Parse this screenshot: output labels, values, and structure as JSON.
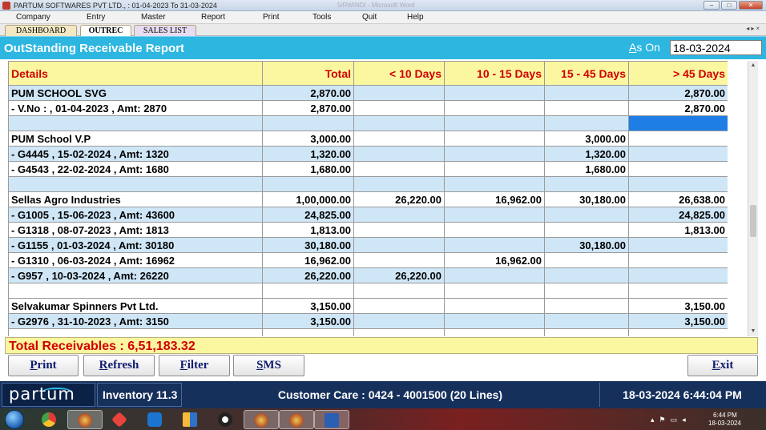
{
  "window": {
    "title": "PARTUM SOFTWARES PVT LTD., : 01-04-2023 To 31-03-2024",
    "faded_title": "5/RWINDI - Microsoft Word"
  },
  "menu": [
    "Company",
    "Entry",
    "Master",
    "Report",
    "Print",
    "Tools",
    "Quit",
    "Help"
  ],
  "tabs": [
    "DASHBOARD",
    "OUTREC",
    "SALES LIST"
  ],
  "report": {
    "title": "OutStanding Receivable Report",
    "as_on_prefix": "A",
    "as_on_rest": "s On",
    "date": "18-03-2024"
  },
  "grid": {
    "columns": [
      "Details",
      "Total",
      "< 10 Days",
      "10 - 15 Days",
      "15 - 45 Days",
      "> 45 Days"
    ],
    "rows": [
      [
        "PUM SCHOOL SVG",
        "2,870.00",
        "",
        "",
        "",
        "2,870.00"
      ],
      [
        " - V.No :  , 01-04-2023 , Amt: 2870",
        "2,870.00",
        "",
        "",
        "",
        "2,870.00"
      ],
      [
        "",
        "",
        "",
        "",
        "",
        ""
      ],
      [
        "PUM School V.P",
        "3,000.00",
        "",
        "",
        "3,000.00",
        ""
      ],
      [
        " - G4445  , 15-02-2024 , Amt: 1320",
        "1,320.00",
        "",
        "",
        "1,320.00",
        ""
      ],
      [
        " - G4543  , 22-02-2024 , Amt: 1680",
        "1,680.00",
        "",
        "",
        "1,680.00",
        ""
      ],
      [
        "",
        "",
        "",
        "",
        "",
        ""
      ],
      [
        "Sellas Agro Industries",
        "1,00,000.00",
        "26,220.00",
        "16,962.00",
        "30,180.00",
        "26,638.00"
      ],
      [
        " - G1005  , 15-06-2023 , Amt: 43600",
        "24,825.00",
        "",
        "",
        "",
        "24,825.00"
      ],
      [
        " - G1318  , 08-07-2023 , Amt: 1813",
        "1,813.00",
        "",
        "",
        "",
        "1,813.00"
      ],
      [
        " - G1155  , 01-03-2024 , Amt: 30180",
        "30,180.00",
        "",
        "",
        "30,180.00",
        ""
      ],
      [
        " - G1310  , 06-03-2024 , Amt: 16962",
        "16,962.00",
        "",
        "16,962.00",
        "",
        ""
      ],
      [
        " - G957  , 10-03-2024 , Amt: 26220",
        "26,220.00",
        "26,220.00",
        "",
        "",
        ""
      ],
      [
        "",
        "",
        "",
        "",
        "",
        ""
      ],
      [
        "Selvakumar Spinners Pvt Ltd.",
        "3,150.00",
        "",
        "",
        "",
        "3,150.00"
      ],
      [
        " - G2976  , 31-10-2023 , Amt: 3150",
        "3,150.00",
        "",
        "",
        "",
        "3,150.00"
      ],
      [
        "",
        "",
        "",
        "",
        "",
        ""
      ]
    ],
    "row_colors": [
      "blue",
      "white",
      "blue",
      "white",
      "blue",
      "white",
      "blue",
      "white",
      "blue",
      "white",
      "blue",
      "white",
      "blue",
      "white",
      "white",
      "blue",
      "white"
    ],
    "selected_cell": [
      2,
      5
    ],
    "selected_color": "#1e7ee6"
  },
  "total": {
    "label": "Total Receivables : 6,51,183.32"
  },
  "buttons": {
    "print": "Print",
    "refresh": "Refresh",
    "filter": "Filter",
    "sms": "SMS",
    "exit": "Exit"
  },
  "status": {
    "brand": "partum",
    "product": "Inventory 11.3",
    "care": "Customer Care : 0424 - 4001500  (20 Lines)",
    "datetime": "18-03-2024 6:44:04 PM"
  },
  "taskbar": {
    "icons": [
      "windows-start-icon",
      "chrome-icon",
      "partum-app-icon",
      "anydesk-icon",
      "teamviewer-icon",
      "file-explorer-icon",
      "remote-icon",
      "partum-app-icon",
      "partum-app-icon",
      "word-icon"
    ],
    "clock_time": "6:44 PM",
    "clock_date": "18-03-2024"
  },
  "colors": {
    "header_blue": "#2cb6e0",
    "header_yellow": "#fbf6a0",
    "header_red": "#d10000",
    "row_blue": "#cfe6f7",
    "status_navy": "#16305c"
  }
}
